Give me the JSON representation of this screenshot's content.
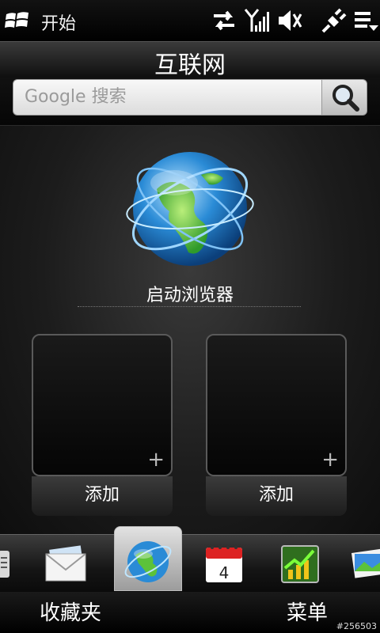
{
  "status_bar": {
    "start_label": "开始",
    "icons": [
      "windows-logo-icon",
      "data-sync-icon",
      "signal-icon",
      "speaker-muted-icon",
      "power-plug-icon",
      "menu-icon"
    ]
  },
  "title": "互联网",
  "search": {
    "placeholder": "Google 搜索"
  },
  "launch": {
    "label": "启动浏览器",
    "icon": "globe-icon"
  },
  "tiles": [
    {
      "label": "添加"
    },
    {
      "label": "添加"
    }
  ],
  "dock": {
    "items": [
      "menu-tab-icon",
      "mail-icon",
      "internet-globe-icon",
      "calendar-icon",
      "stocks-icon",
      "photos-icon"
    ],
    "calendar_day": "4",
    "active": "internet-globe-icon"
  },
  "softkeys": {
    "left": "收藏夹",
    "right": "菜单"
  },
  "watermark": "#256503",
  "colors": {
    "background": "#0b0b0b",
    "accent_blue": "#2a8bd6",
    "land_green": "#5cc23a"
  }
}
